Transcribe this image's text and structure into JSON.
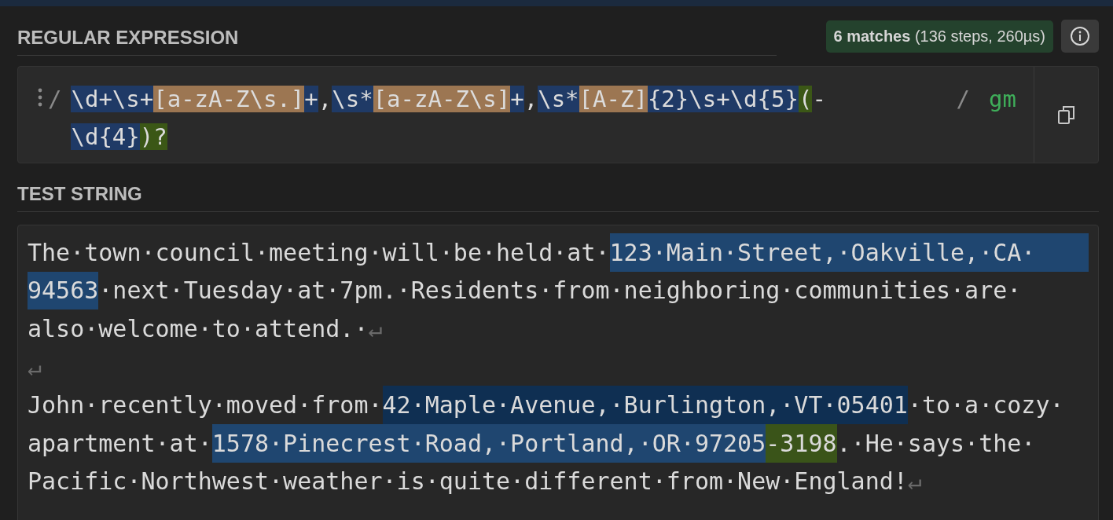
{
  "regex_section": {
    "heading": "REGULAR EXPRESSION",
    "match_info": "**6 matches** (136 steps, 260µs)",
    "delimiter_open": "/",
    "delimiter_close": "/",
    "flags": "gm",
    "tokens": [
      {
        "text": "\\d+\\s+",
        "kind": "token"
      },
      {
        "text": "[a-zA-Z\\s.]",
        "kind": "set"
      },
      {
        "text": "+",
        "kind": "token"
      },
      {
        "text": ",",
        "kind": "plain"
      },
      {
        "text": "\\s*",
        "kind": "token"
      },
      {
        "text": "[a-zA-Z\\s]",
        "kind": "set"
      },
      {
        "text": "+",
        "kind": "token"
      },
      {
        "text": ",",
        "kind": "plain"
      },
      {
        "text": "\\s*",
        "kind": "token"
      },
      {
        "text": "[A-Z]",
        "kind": "set"
      },
      {
        "text": "{2}\\s+\\d{5}",
        "kind": "token"
      },
      {
        "text": "(",
        "kind": "group"
      },
      {
        "text": "-",
        "kind": "plain"
      },
      {
        "text": "\\d{4}",
        "kind": "token"
      },
      {
        "text": ")?",
        "kind": "group"
      }
    ]
  },
  "test_section": {
    "heading": "TEST STRING",
    "lines": [
      [
        {
          "text": "The·town·council·meeting·will·be·held·at·",
          "kind": "plain"
        },
        {
          "text": "123·Main·Street,·Oakville,·CA·",
          "kind": "match"
        }
      ],
      [
        {
          "text": "94563",
          "kind": "match"
        },
        {
          "text": "·next·Tuesday·at·7pm.·Residents·from·neighboring·communities·are·",
          "kind": "plain"
        }
      ],
      [
        {
          "text": "also·welcome·to·attend.·",
          "kind": "plain"
        },
        {
          "text": "↵",
          "kind": "newline"
        }
      ],
      [
        {
          "text": "↵",
          "kind": "newline"
        }
      ],
      [
        {
          "text": "John·recently·moved·from·",
          "kind": "plain"
        },
        {
          "text": "42·Maple·Avenue,·Burlington,·VT·05401",
          "kind": "match_alt"
        },
        {
          "text": "·to·a·cozy·",
          "kind": "plain"
        }
      ],
      [
        {
          "text": "apartment·at·",
          "kind": "plain"
        },
        {
          "text": "1578·Pinecrest·Road,·Portland,·OR·97205",
          "kind": "match"
        },
        {
          "text": "-3198",
          "kind": "group"
        },
        {
          "text": ".·He·says·the·",
          "kind": "plain"
        }
      ],
      [
        {
          "text": "Pacific·Northwest·weather·is·quite·different·from·New·England!",
          "kind": "plain"
        },
        {
          "text": "↵",
          "kind": "newline"
        }
      ]
    ]
  }
}
